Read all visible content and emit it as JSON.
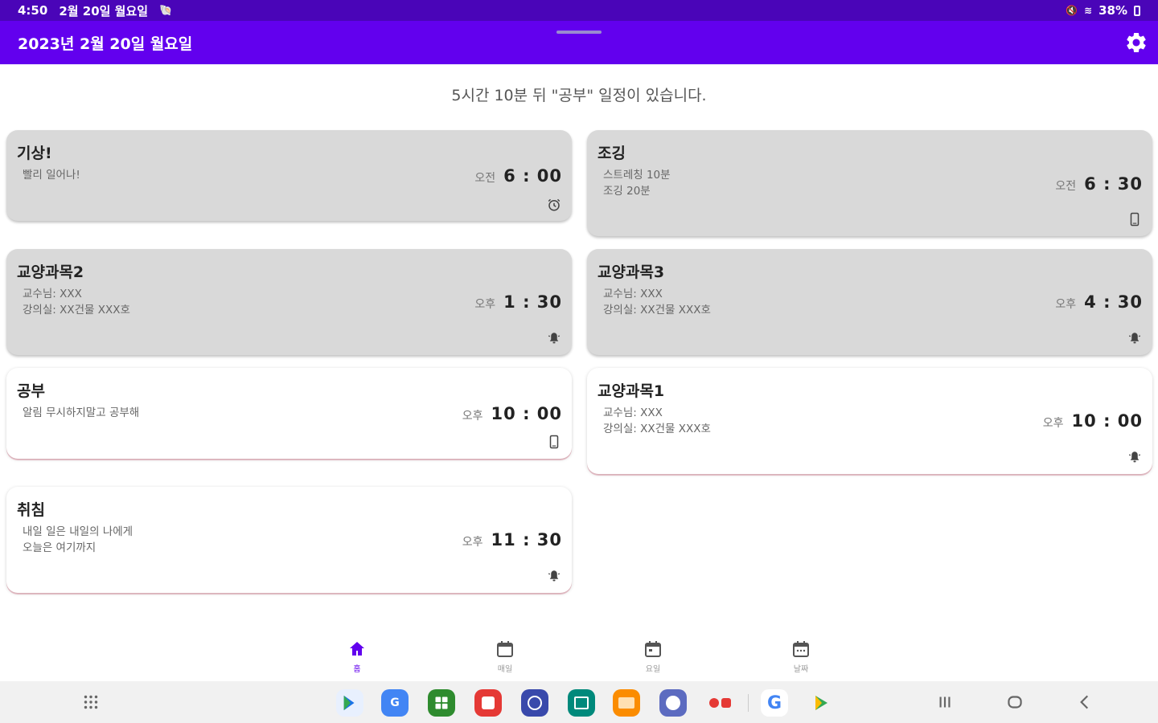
{
  "status": {
    "time": "4:50",
    "date": "2월 20일 월요일",
    "battery": "38%"
  },
  "appbar": {
    "title": "2023년 2월 20일 월요일"
  },
  "notice": "5시간 10분 뒤 \"공부\" 일정이 있습니다.",
  "cards": [
    {
      "title": "기상!",
      "lines": [
        "빨리 일어나!"
      ],
      "ampm": "오전",
      "time": "6 : 00",
      "icon": "alarm-icon"
    },
    {
      "title": "조깅",
      "lines": [
        "스트레칭 10분",
        "조깅 20분"
      ],
      "ampm": "오전",
      "time": "6 : 30",
      "icon": "phone-icon"
    },
    {
      "title": "교양과목2",
      "lines": [
        "교수님: XXX",
        "강의실: XX건물 XXX호"
      ],
      "ampm": "오후",
      "time": "1 : 30",
      "icon": "bell-icon"
    },
    {
      "title": "교양과목3",
      "lines": [
        "교수님: XXX",
        "강의실: XX건물 XXX호"
      ],
      "ampm": "오후",
      "time": "4 : 30",
      "icon": "bell-icon"
    },
    {
      "title": "공부",
      "lines": [
        "알림 무시하지말고 공부해"
      ],
      "ampm": "오후",
      "time": "10 : 00",
      "icon": "phone-icon"
    },
    {
      "title": "교양과목1",
      "lines": [
        "교수님: XXX",
        "강의실: XX건물 XXX호"
      ],
      "ampm": "오후",
      "time": "10 : 00",
      "icon": "bell-icon"
    },
    {
      "title": "취침",
      "lines": [
        "내일 일은 내일의 나에게",
        "오늘은 여기까지"
      ],
      "ampm": "오후",
      "time": "11 : 30",
      "icon": "bell-icon"
    }
  ],
  "nav": [
    {
      "label": "홈",
      "icon": "home-icon"
    },
    {
      "label": "매일",
      "icon": "calendar-icon"
    },
    {
      "label": "요일",
      "icon": "calendar-icon"
    },
    {
      "label": "날짜",
      "icon": "calendar-icon"
    }
  ],
  "colors": {
    "status_bar": "#4a05b8",
    "app_bar": "#6200ee",
    "card_gray": "#d9d9d9",
    "accent": "#6200ee"
  },
  "taskbar_apps": [
    "play-store-icon",
    "translate-icon",
    "calculator-icon",
    "notes-icon",
    "compass-icon",
    "calendar-app-icon",
    "folder-icon",
    "chat-icon",
    "camera-icon",
    "google-icon",
    "play-games-icon"
  ]
}
